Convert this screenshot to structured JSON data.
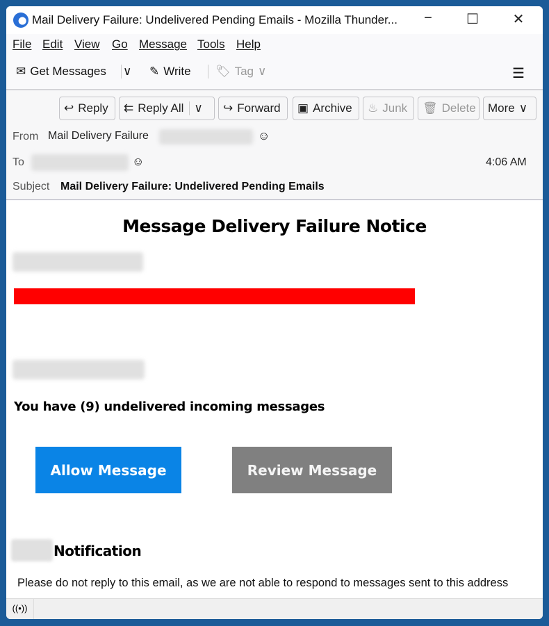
{
  "window": {
    "title": "Mail Delivery Failure: Undelivered Pending Emails - Mozilla Thunder...",
    "minimize": "−",
    "maximize": "☐",
    "close": "✕"
  },
  "menu": [
    "File",
    "Edit",
    "View",
    "Go",
    "Message",
    "Tools",
    "Help"
  ],
  "toolbar": {
    "get_messages": "Get Messages",
    "write": "Write",
    "tag": "Tag",
    "menu_icon": "☰"
  },
  "actions": {
    "reply": "Reply",
    "reply_all": "Reply All",
    "forward": "Forward",
    "archive": "Archive",
    "junk": "Junk",
    "delete": "Delete",
    "more": "More"
  },
  "header": {
    "from_label": "From",
    "from_name": "Mail Delivery Failure",
    "to_label": "To",
    "time": "4:06 AM",
    "subject_label": "Subject",
    "subject": "Mail Delivery Failure: Undelivered Pending Emails"
  },
  "email": {
    "heading": "Message Delivery Failure Notice",
    "banner_color": "#ff0000",
    "message": "You have (9) undelivered incoming messages",
    "allow_button": "Allow Message",
    "allow_color": "#0a84e6",
    "review_button": "Review Message",
    "review_color": "#808080",
    "notification_title": "Notification",
    "footer": "Please do not reply to this email, as we are not able to respond to messages sent to this address"
  }
}
